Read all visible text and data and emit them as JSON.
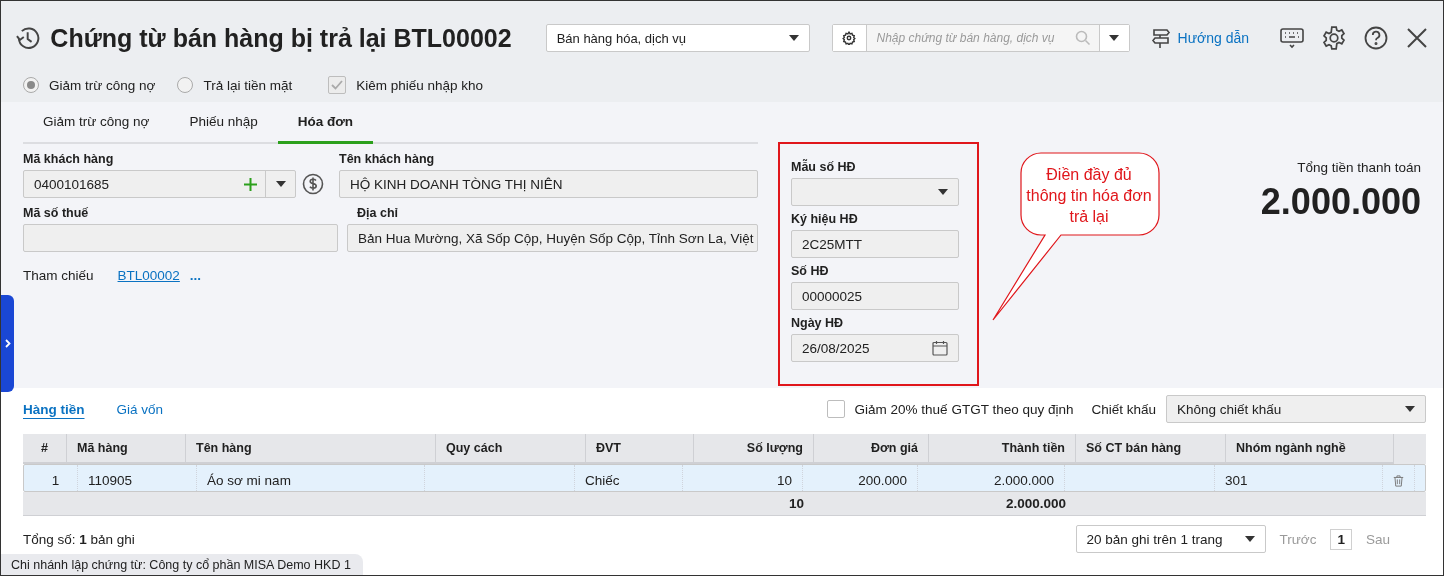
{
  "window": {
    "title": "Chứng từ bán hàng bị trả lại BTL00002"
  },
  "business_type": {
    "value": "Bán hàng hóa, dịch vụ"
  },
  "search": {
    "placeholder": "Nhập chứng từ bán hàng, dịch vụ"
  },
  "guide_link": "Hướng dẫn",
  "payment_options": [
    {
      "label": "Giảm trừ công nợ",
      "selected": true
    },
    {
      "label": "Trả lại tiền mặt",
      "selected": false
    }
  ],
  "stock_receipt": {
    "label": "Kiêm phiếu nhập kho",
    "checked": true,
    "disabled": true
  },
  "tabs": [
    {
      "label": "Giảm trừ công nợ",
      "selected": false
    },
    {
      "label": "Phiếu nhập",
      "selected": false
    },
    {
      "label": "Hóa đơn",
      "selected": true
    }
  ],
  "customer": {
    "code_label": "Mã khách hàng",
    "code": "0400101685",
    "name_label": "Tên khách hàng",
    "name": "HỘ KINH DOANH TÒNG THỊ NIÊN",
    "tax_label": "Mã số thuế",
    "address_label": "Địa chỉ",
    "address": "Bản Hua Mường, Xã Sốp Cộp, Huyện Sốp Cộp, Tỉnh Sơn La, Việt"
  },
  "reference": {
    "label": "Tham chiếu",
    "link": "BTL00002",
    "more": "..."
  },
  "invoice_fields": [
    {
      "kind": "select",
      "label": "Mẫu số HĐ"
    },
    {
      "kind": "text",
      "label": "Ký hiệu HĐ",
      "value": "2C25MTT"
    },
    {
      "kind": "text",
      "label": "Số HĐ",
      "value": "00000025"
    },
    {
      "kind": "date",
      "label": "Ngày HĐ",
      "value": "26/08/2025"
    }
  ],
  "callout": "Điền đầy đủ thông tin hóa đơn trả lại",
  "total": {
    "label": "Tổng tiền thanh toán",
    "value": "2.000.000"
  },
  "detail_tabs": [
    {
      "label": "Hàng tiền",
      "selected": true
    },
    {
      "label": "Giá vốn",
      "selected": false
    }
  ],
  "vat_reduction": {
    "label": "Giảm 20% thuế GTGT theo quy định",
    "checked": false
  },
  "discount": {
    "label": "Chiết khấu",
    "value": "Không chiết khấu"
  },
  "table": {
    "columns": [
      {
        "label": "#",
        "kind": "center"
      },
      {
        "label": "Mã hàng",
        "kind": "text"
      },
      {
        "label": "Tên hàng",
        "kind": "text"
      },
      {
        "label": "Quy cách",
        "kind": "text"
      },
      {
        "label": "ĐVT",
        "kind": "text"
      },
      {
        "label": "Số lượng",
        "kind": "number",
        "total": "10"
      },
      {
        "label": "Đơn giá",
        "kind": "number"
      },
      {
        "label": "Thành tiền",
        "kind": "number",
        "total": "2.000.000"
      },
      {
        "label": "Số CT bán hàng",
        "kind": "text"
      },
      {
        "label": "Nhóm ngành nghề",
        "kind": "text"
      }
    ],
    "rows": [
      {
        "selected": true,
        "cells": [
          {
            "text": "1"
          },
          {
            "text": "110905"
          },
          {
            "text": "Áo sơ mi nam"
          },
          {},
          {
            "text": "Chiếc"
          },
          {
            "text": "10"
          },
          {
            "text": "200.000"
          },
          {
            "text": "2.000.000"
          },
          {},
          {
            "text": "301"
          }
        ]
      }
    ]
  },
  "record_count": "Tổng số: **1** bản ghi",
  "pagination": {
    "page_size": "20 bản ghi trên 1 trang",
    "prev": "Trước",
    "page": "1",
    "next": "Sau"
  },
  "branch": "Chi nhánh lập chứng từ: Công ty cổ phần MISA Demo HKD 1"
}
